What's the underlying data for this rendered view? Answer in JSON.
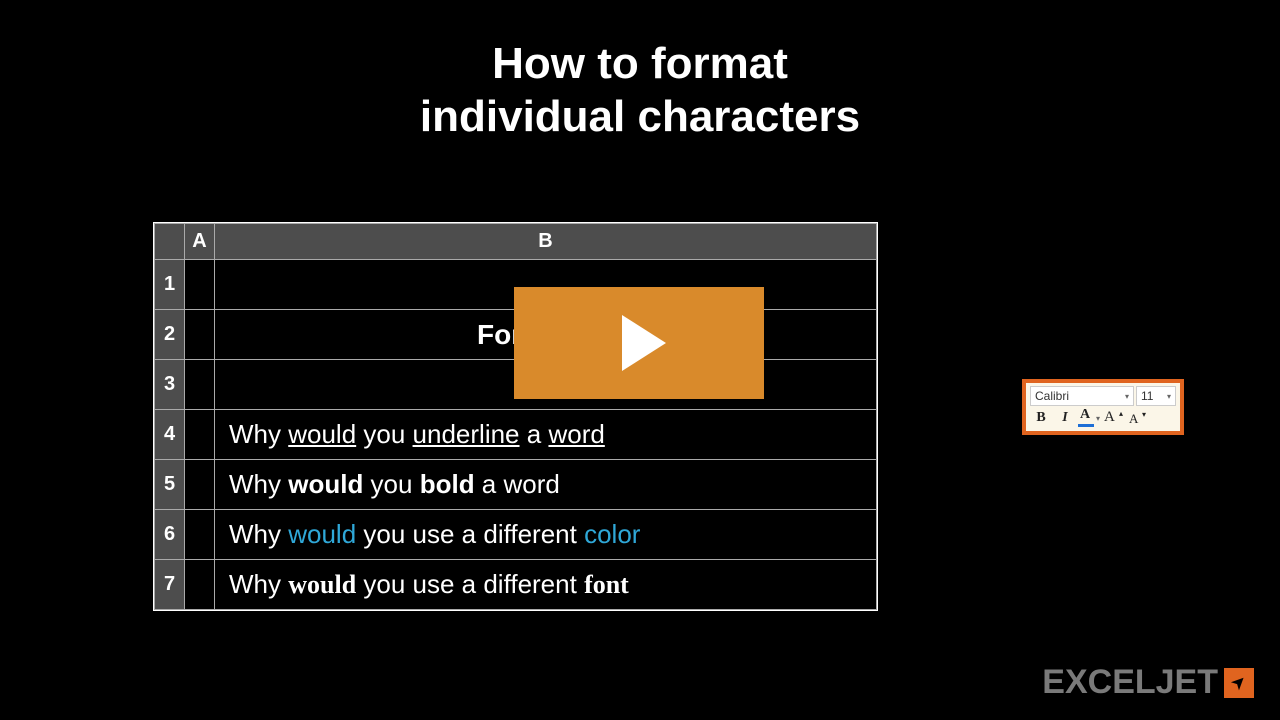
{
  "title_line1": "How to format",
  "title_line2": "individual characters",
  "columns": {
    "A": "A",
    "B": "B"
  },
  "rows": {
    "r1": "1",
    "r2": "2",
    "r3": "3",
    "r4": "4",
    "r5": "5",
    "r6": "6",
    "r7": "7"
  },
  "cells": {
    "b2": "Formating",
    "b4": {
      "p1": "Why ",
      "u1": "would",
      "p2": " you ",
      "u2": "underline",
      "p3": " a ",
      "u3": "word"
    },
    "b5": {
      "p1": "Why ",
      "b1": "would",
      "p2": " you ",
      "b2": "bold",
      "p3": " a word"
    },
    "b6": {
      "p1": "Why ",
      "c1": "would",
      "p2": " you use a different ",
      "c2": "color"
    },
    "b7": {
      "p1": "Why ",
      "f1": "would",
      "p2": " you use a different ",
      "f2": "font"
    }
  },
  "minitoolbar": {
    "font_name": "Calibri",
    "font_size": "11",
    "bold": "B",
    "italic": "I",
    "fontcolor_letter": "A",
    "grow_letter": "A",
    "grow_arrow": "▴",
    "shrink_letter": "A",
    "shrink_arrow": "▾",
    "dropdown_glyph": "▾"
  },
  "logo": {
    "text": "EXCELJET"
  }
}
